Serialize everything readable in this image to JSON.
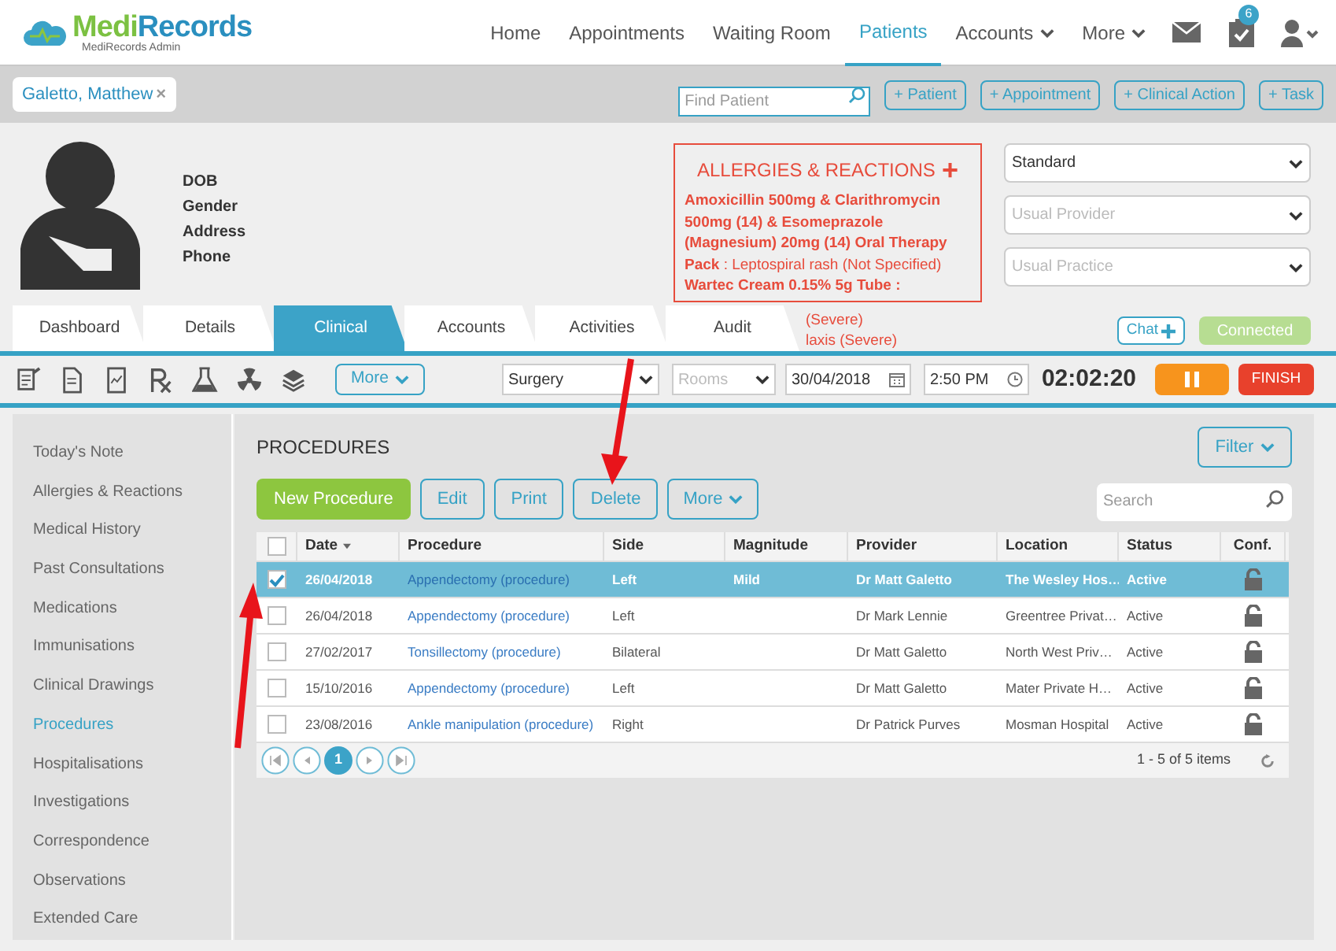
{
  "brand": {
    "name_part_1": "Medi",
    "name_part_2": "Records",
    "subtitle": "MediRecords Admin"
  },
  "nav": [
    {
      "label": "Home",
      "selected": false,
      "dropdown": false
    },
    {
      "label": "Appointments",
      "selected": false,
      "dropdown": false
    },
    {
      "label": "Waiting Room",
      "selected": false,
      "dropdown": false
    },
    {
      "label": "Patients",
      "selected": true,
      "dropdown": false
    },
    {
      "label": "Accounts",
      "selected": false,
      "dropdown": true
    },
    {
      "label": "More",
      "selected": false,
      "dropdown": true
    }
  ],
  "tasks_badge": "6",
  "patient_tab": {
    "label": "Galetto, Matthew",
    "close": "×"
  },
  "find_patient": {
    "placeholder": "Find Patient"
  },
  "quick_buttons": [
    "+ Patient",
    "+ Appointment",
    "+ Clinical Action",
    "+ Task"
  ],
  "patient_fields": [
    "DOB",
    "Gender",
    "Address",
    "Phone"
  ],
  "allergies": {
    "title": "ALLERGIES & REACTIONS",
    "add": "+",
    "items": [
      {
        "drug": "Amoxicillin 500mg & Clarithromycin 500mg (14) & Esomeprazole (Magnesium) 20mg (14) Oral Therapy Pack",
        "reaction": ": Leptospiral rash (Not Specified)"
      },
      {
        "drug": "Wartec Cream 0.15% 5g Tube :"
      }
    ],
    "overflow_fragments": [
      "(Severe)",
      "laxis (Severe)"
    ]
  },
  "selects": [
    {
      "value": "Standard"
    },
    {
      "placeholder": "Usual Provider"
    },
    {
      "placeholder": "Usual Practice"
    }
  ],
  "tabs": [
    {
      "label": "Dashboard",
      "selected": false
    },
    {
      "label": "Details",
      "selected": false
    },
    {
      "label": "Clinical",
      "selected": true
    },
    {
      "label": "Accounts",
      "selected": false
    },
    {
      "label": "Activities",
      "selected": false
    },
    {
      "label": "Audit",
      "selected": false
    }
  ],
  "chat_button": "Chat",
  "connection_status": "Connected",
  "toolbar": {
    "more": "More",
    "location": "Surgery",
    "rooms": "Rooms",
    "date": "30/04/2018",
    "time": "2:50 PM",
    "timer": "02:02:20",
    "finish": "FINISH"
  },
  "sidebar": [
    {
      "label": "Today's Note",
      "selected": false
    },
    {
      "label": "Allergies & Reactions",
      "selected": false
    },
    {
      "label": "Medical History",
      "selected": false
    },
    {
      "label": "Past Consultations",
      "selected": false
    },
    {
      "label": "Medications",
      "selected": false
    },
    {
      "label": "Immunisations",
      "selected": false
    },
    {
      "label": "Clinical Drawings",
      "selected": false
    },
    {
      "label": "Procedures",
      "selected": true
    },
    {
      "label": "Hospitalisations",
      "selected": false
    },
    {
      "label": "Investigations",
      "selected": false
    },
    {
      "label": "Correspondence",
      "selected": false
    },
    {
      "label": "Observations",
      "selected": false
    },
    {
      "label": "Extended Care",
      "selected": false
    }
  ],
  "section_title": "PROCEDURES",
  "filter": "Filter",
  "actions": [
    {
      "label": "New Procedure",
      "kind": "primary"
    },
    {
      "label": "Edit",
      "kind": "outline"
    },
    {
      "label": "Print",
      "kind": "outline"
    },
    {
      "label": "Delete",
      "kind": "outline"
    },
    {
      "label": "More",
      "kind": "dropdown"
    }
  ],
  "search": {
    "placeholder": "Search"
  },
  "table": {
    "columns": [
      "Date",
      "Procedure",
      "Side",
      "Magnitude",
      "Provider",
      "Location",
      "Status",
      "Conf."
    ],
    "header_checked": false,
    "rows": [
      {
        "selected": true,
        "checked": true,
        "cells": [
          "26/04/2018",
          "Appendectomy (procedure)",
          "Left",
          "Mild",
          "Dr Matt Galetto",
          "The Wesley Hos…",
          "Active"
        ]
      },
      {
        "selected": false,
        "checked": false,
        "cells": [
          "26/04/2018",
          "Appendectomy (procedure)",
          "Left",
          "",
          "Dr Mark Lennie",
          "Greentree Privat…",
          "Active"
        ]
      },
      {
        "selected": false,
        "checked": false,
        "cells": [
          "27/02/2017",
          "Tonsillectomy (procedure)",
          "Bilateral",
          "",
          "Dr Matt Galetto",
          "North West Priv…",
          "Active"
        ]
      },
      {
        "selected": false,
        "checked": false,
        "cells": [
          "15/10/2016",
          "Appendectomy (procedure)",
          "Left",
          "",
          "Dr Matt Galetto",
          "Mater Private H…",
          "Active"
        ]
      },
      {
        "selected": false,
        "checked": false,
        "cells": [
          "23/08/2016",
          "Ankle manipulation (procedure)",
          "Right",
          "",
          "Dr Patrick Purves",
          "Mosman Hospital",
          "Active"
        ]
      }
    ]
  },
  "pager": {
    "pages": [
      {
        "label": "1",
        "selected": true
      }
    ],
    "summary": "1 - 5 of 5 items"
  }
}
